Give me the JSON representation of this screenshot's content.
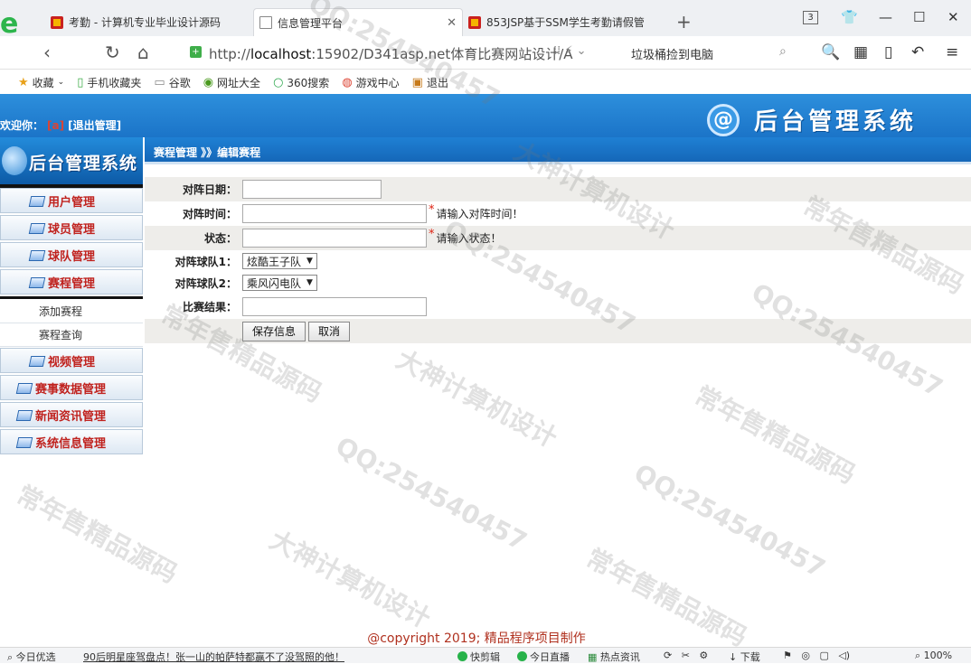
{
  "browser": {
    "brand_icon": "360-browser-logo",
    "tabs": [
      {
        "title": "考勤 - 计算机专业毕业设计源码",
        "icon": "red-favicon",
        "active": false
      },
      {
        "title": "信息管理平台",
        "icon": "document-favicon",
        "active": true
      },
      {
        "title": "853JSP基于SSM学生考勤请假管",
        "icon": "red-favicon",
        "active": false
      }
    ],
    "tab_count": "3",
    "url_prefix": "http://",
    "url_host": "localhost",
    "url_rest": ":15902/D341asp.net体育比赛网站设计/A",
    "search_hint": "垃圾桶捡到电脑",
    "bookmarks": [
      {
        "label": "收藏",
        "icon": "star-icon"
      },
      {
        "label": "手机收藏夹",
        "icon": "phone-icon"
      },
      {
        "label": "谷歌",
        "icon": "page-icon"
      },
      {
        "label": "网址大全",
        "icon": "globe-icon"
      },
      {
        "label": "360搜索",
        "icon": "360-search-icon"
      },
      {
        "label": "游戏中心",
        "icon": "game-icon"
      },
      {
        "label": "退出",
        "icon": "exit-icon"
      }
    ]
  },
  "header": {
    "title": "后台管理系统",
    "welcome_prefix": "欢迎你：",
    "username": "[a]",
    "logout": "[退出管理]"
  },
  "sidebar": {
    "logo_text": "后台管理系统",
    "menus": [
      {
        "label": "用户管理"
      },
      {
        "label": "球员管理"
      },
      {
        "label": "球队管理"
      },
      {
        "label": "赛程管理"
      }
    ],
    "submenu": [
      {
        "label": "添加赛程"
      },
      {
        "label": "赛程查询"
      }
    ],
    "menus_after": [
      {
        "label": "视频管理"
      },
      {
        "label": "赛事数据管理"
      },
      {
        "label": "新闻资讯管理"
      },
      {
        "label": "系统信息管理"
      }
    ]
  },
  "breadcrumb": "赛程管理 》》编辑赛程",
  "form": {
    "date_label": "对阵日期：",
    "date_value": "",
    "time_label": "对阵时间：",
    "time_value": "",
    "time_hint": "请输入对阵时间！",
    "status_label": "状态：",
    "status_value": "",
    "status_hint": "请输入状态！",
    "team1_label": "对阵球队1：",
    "team1_value": "炫酷王子队",
    "team2_label": "对阵球队2：",
    "team2_value": "乘风闪电队",
    "result_label": "比赛结果：",
    "result_value": "",
    "required_mark": "*",
    "save_button": "保存信息",
    "cancel_button": "取消"
  },
  "copyright": "@copyright 2019; 精品程序项目制作",
  "statusbar": {
    "today": "今日优选",
    "news": "90后明星座驾盘点！张一山的帕萨特都赢不了没驾照的他！",
    "speed_edit": "快剪辑",
    "live": "今日直播",
    "hot": "热点资讯",
    "download": "下载",
    "zoom": "100%"
  },
  "watermarks": [
    "QQ:254540457",
    "常年售精品源码",
    "大神计算机设计"
  ]
}
